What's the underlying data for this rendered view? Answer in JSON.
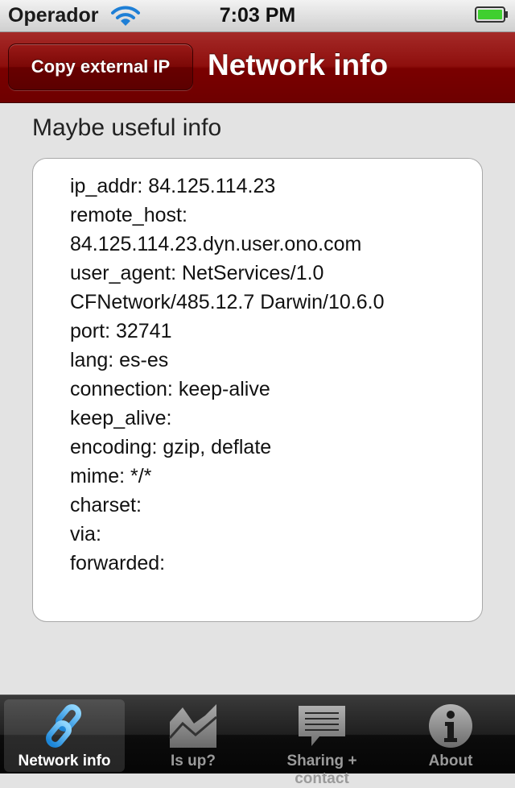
{
  "status_bar": {
    "carrier": "Operador",
    "time": "7:03 PM"
  },
  "nav_bar": {
    "left_button": "Copy external IP",
    "title": "Network info"
  },
  "content": {
    "section_title": "Maybe useful info",
    "lines": [
      "ip_addr: 84.125.114.23",
      "remote_host:",
      "84.125.114.23.dyn.user.ono.com",
      "user_agent: NetServices/1.0",
      "CFNetwork/485.12.7 Darwin/10.6.0",
      "port: 32741",
      "lang: es-es",
      "connection: keep-alive",
      "keep_alive:",
      "encoding: gzip, deflate",
      "mime: */*",
      "charset:",
      "via:",
      "forwarded:"
    ]
  },
  "tab_bar": {
    "tabs": [
      {
        "label": "Network info",
        "icon": "chain-link-icon",
        "selected": true
      },
      {
        "label": "Is up?",
        "icon": "area-chart-icon",
        "selected": false
      },
      {
        "label": "Sharing + contact",
        "icon": "speech-bubble-icon",
        "selected": false
      },
      {
        "label": "About",
        "icon": "info-icon",
        "selected": false
      }
    ]
  },
  "colors": {
    "nav_red": "#8e0f0d",
    "selected_tab_accent": "#3aa6ee"
  }
}
